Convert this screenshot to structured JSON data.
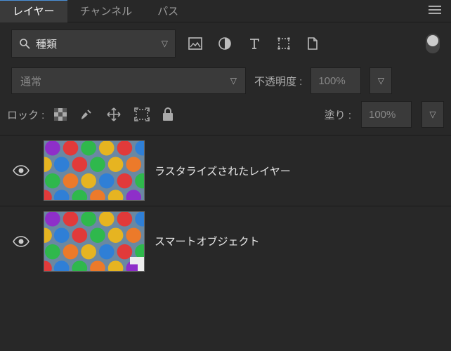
{
  "tabs": {
    "layers": "レイヤー",
    "channels": "チャンネル",
    "paths": "パス"
  },
  "search": {
    "placeholder": "種類"
  },
  "blend": {
    "mode": "通常",
    "opacity_label": "不透明度 :",
    "opacity_value": "100%"
  },
  "lock": {
    "label": "ロック :",
    "fill_label": "塗り :",
    "fill_value": "100%"
  },
  "layers": [
    {
      "name": "ラスタライズされたレイヤー",
      "smart": false
    },
    {
      "name": "スマートオブジェクト",
      "smart": true
    }
  ]
}
